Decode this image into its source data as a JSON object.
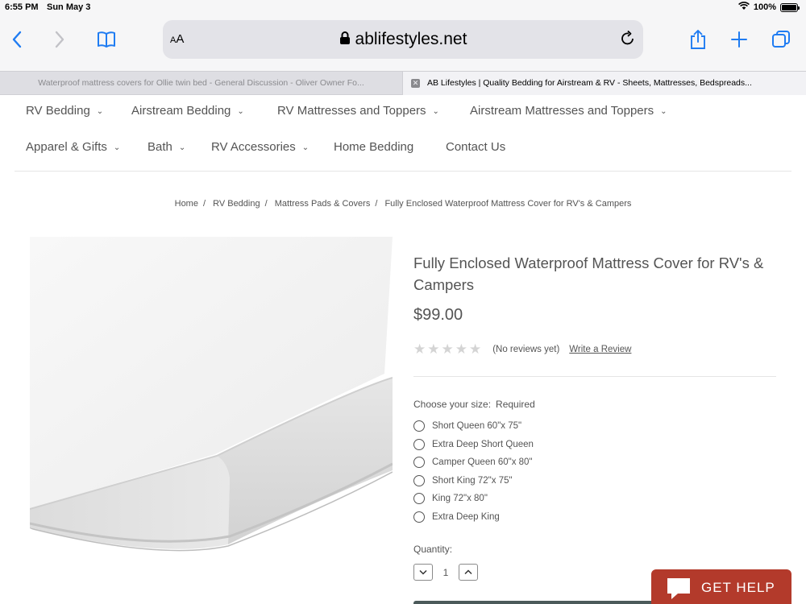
{
  "status_bar": {
    "time": "6:55 PM",
    "date": "Sun May 3",
    "battery": "100%"
  },
  "browser": {
    "aa_label": "AA",
    "url": "ablifestyles.net",
    "tabs": [
      {
        "title": "Waterproof mattress covers for Ollie twin bed - General Discussion - Oliver Owner Fo..."
      },
      {
        "title": "AB Lifestyles | Quality Bedding for Airstream & RV - Sheets, Mattresses, Bedspreads..."
      }
    ]
  },
  "nav": {
    "row1": [
      {
        "label": "RV Bedding",
        "has_caret": true
      },
      {
        "label": "Airstream Bedding",
        "has_caret": true
      },
      {
        "label": "RV Mattresses and Toppers",
        "has_caret": true
      },
      {
        "label": "Airstream Mattresses and Toppers",
        "has_caret": true
      }
    ],
    "row2": [
      {
        "label": "Apparel & Gifts",
        "has_caret": true
      },
      {
        "label": "Bath",
        "has_caret": true
      },
      {
        "label": "RV Accessories",
        "has_caret": true
      },
      {
        "label": "Home Bedding",
        "has_caret": false
      },
      {
        "label": "Contact Us",
        "has_caret": false
      }
    ]
  },
  "breadcrumb": [
    "Home",
    "RV Bedding",
    "Mattress Pads & Covers",
    "Fully Enclosed Waterproof Mattress Cover for RV's & Campers"
  ],
  "product": {
    "title": "Fully Enclosed Waterproof Mattress Cover for RV's & Campers",
    "price": "$99.00",
    "stars": "★★★★★",
    "no_reviews": "(No reviews yet)",
    "write_review": "Write a Review",
    "size_label": "Choose your size:",
    "size_required": "Required",
    "sizes": [
      "Short Queen 60\"x 75\"",
      "Extra Deep Short Queen",
      "Camper Queen 60\"x 80\"",
      "Short King 72\"x 75\"",
      "King 72\"x 80\"",
      "Extra Deep King"
    ],
    "quantity_label": "Quantity:",
    "quantity": "1"
  },
  "help_widget": {
    "label": "GET HELP",
    "color": "#b33a2b"
  }
}
